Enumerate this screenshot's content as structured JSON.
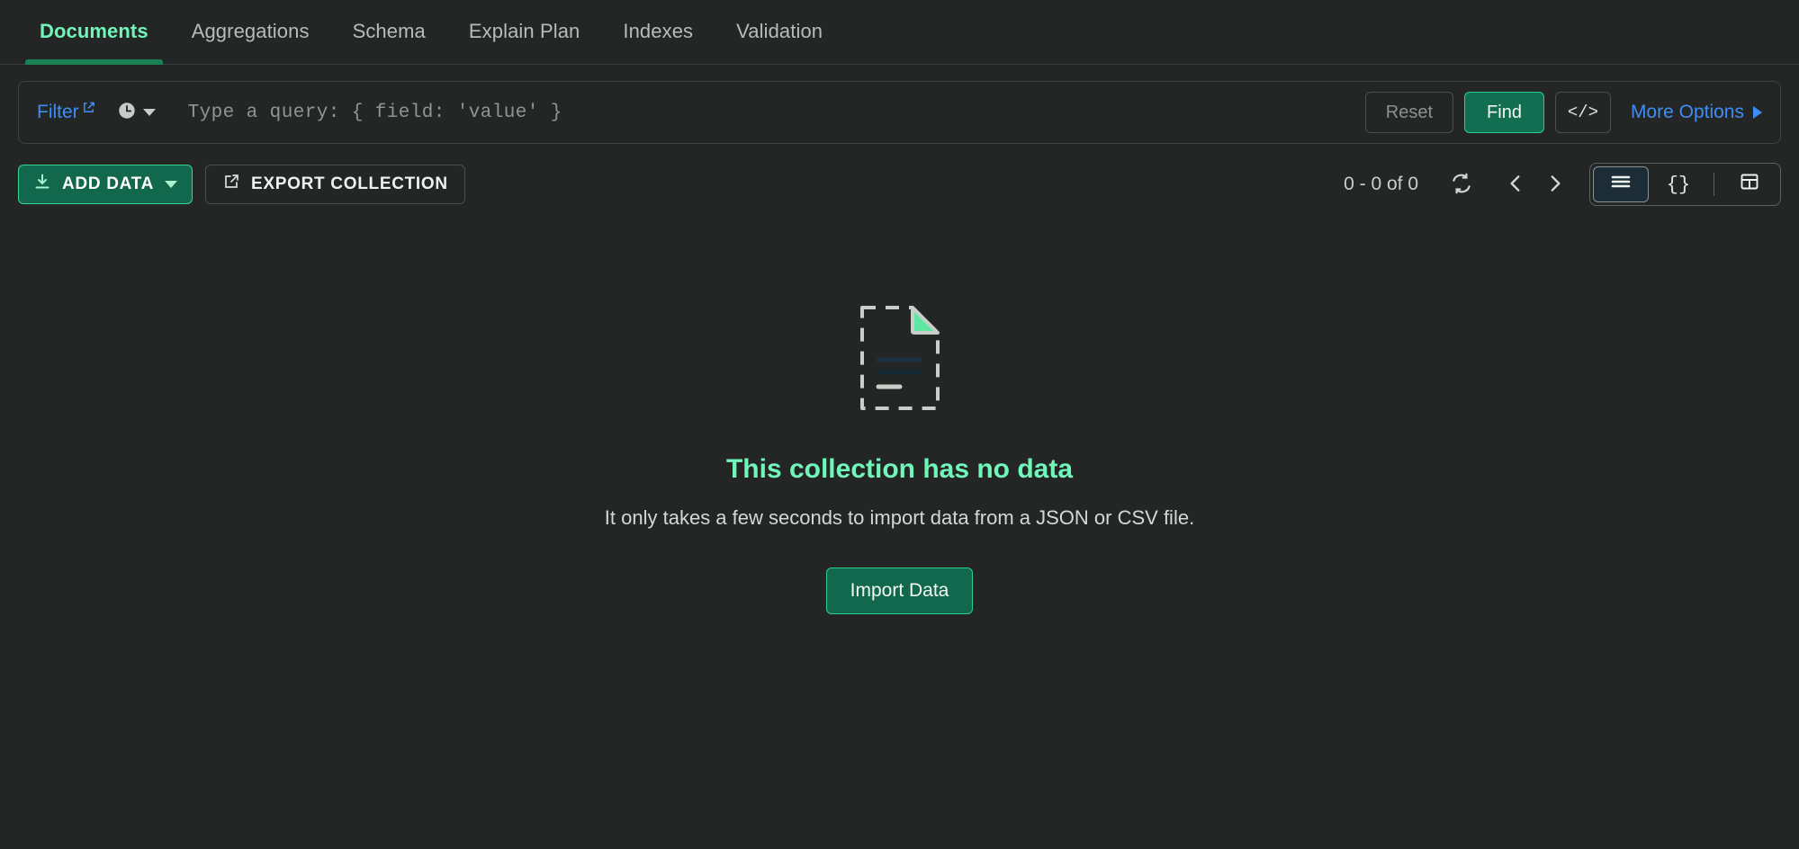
{
  "tabs": [
    {
      "label": "Documents",
      "active": true
    },
    {
      "label": "Aggregations",
      "active": false
    },
    {
      "label": "Schema",
      "active": false
    },
    {
      "label": "Explain Plan",
      "active": false
    },
    {
      "label": "Indexes",
      "active": false
    },
    {
      "label": "Validation",
      "active": false
    }
  ],
  "query_bar": {
    "filter_label": "Filter",
    "query_value": "",
    "query_placeholder": "Type a query: { field: 'value' }",
    "reset_label": "Reset",
    "find_label": "Find",
    "export_to_language_label": "</>",
    "more_options_label": "More Options",
    "history_icon": "clock-icon",
    "external_link_icon": "external-link-icon",
    "caret_icon": "chevron-down-icon",
    "more_options_caret": "chevron-right-icon"
  },
  "toolbar": {
    "add_data_label": "ADD DATA",
    "add_data_icon": "download-icon",
    "export_collection_label": "EXPORT COLLECTION",
    "export_collection_icon": "export-icon",
    "doc_count": "0 - 0 of 0",
    "refresh_icon": "refresh-icon",
    "prev_icon": "chevron-left-icon",
    "next_icon": "chevron-right-icon",
    "views": [
      {
        "name": "list",
        "icon": "list-icon",
        "selected": true
      },
      {
        "name": "json",
        "icon": "braces-icon",
        "label": "{}",
        "selected": false
      },
      {
        "name": "table",
        "icon": "table-icon",
        "selected": false
      }
    ]
  },
  "empty_state": {
    "illustration": "empty-document-icon",
    "title": "This collection has no data",
    "description": "It only takes a few seconds to import data from a JSON or CSV file.",
    "import_button_label": "Import Data"
  },
  "colors": {
    "background": "#242626",
    "accent_green": "#71f6ba",
    "button_green": "#12684d",
    "border_green": "#2bd08a",
    "link_blue": "#3d8df5",
    "tab_underline": "#1a8055",
    "selected_view_bg": "#1c2d38"
  }
}
